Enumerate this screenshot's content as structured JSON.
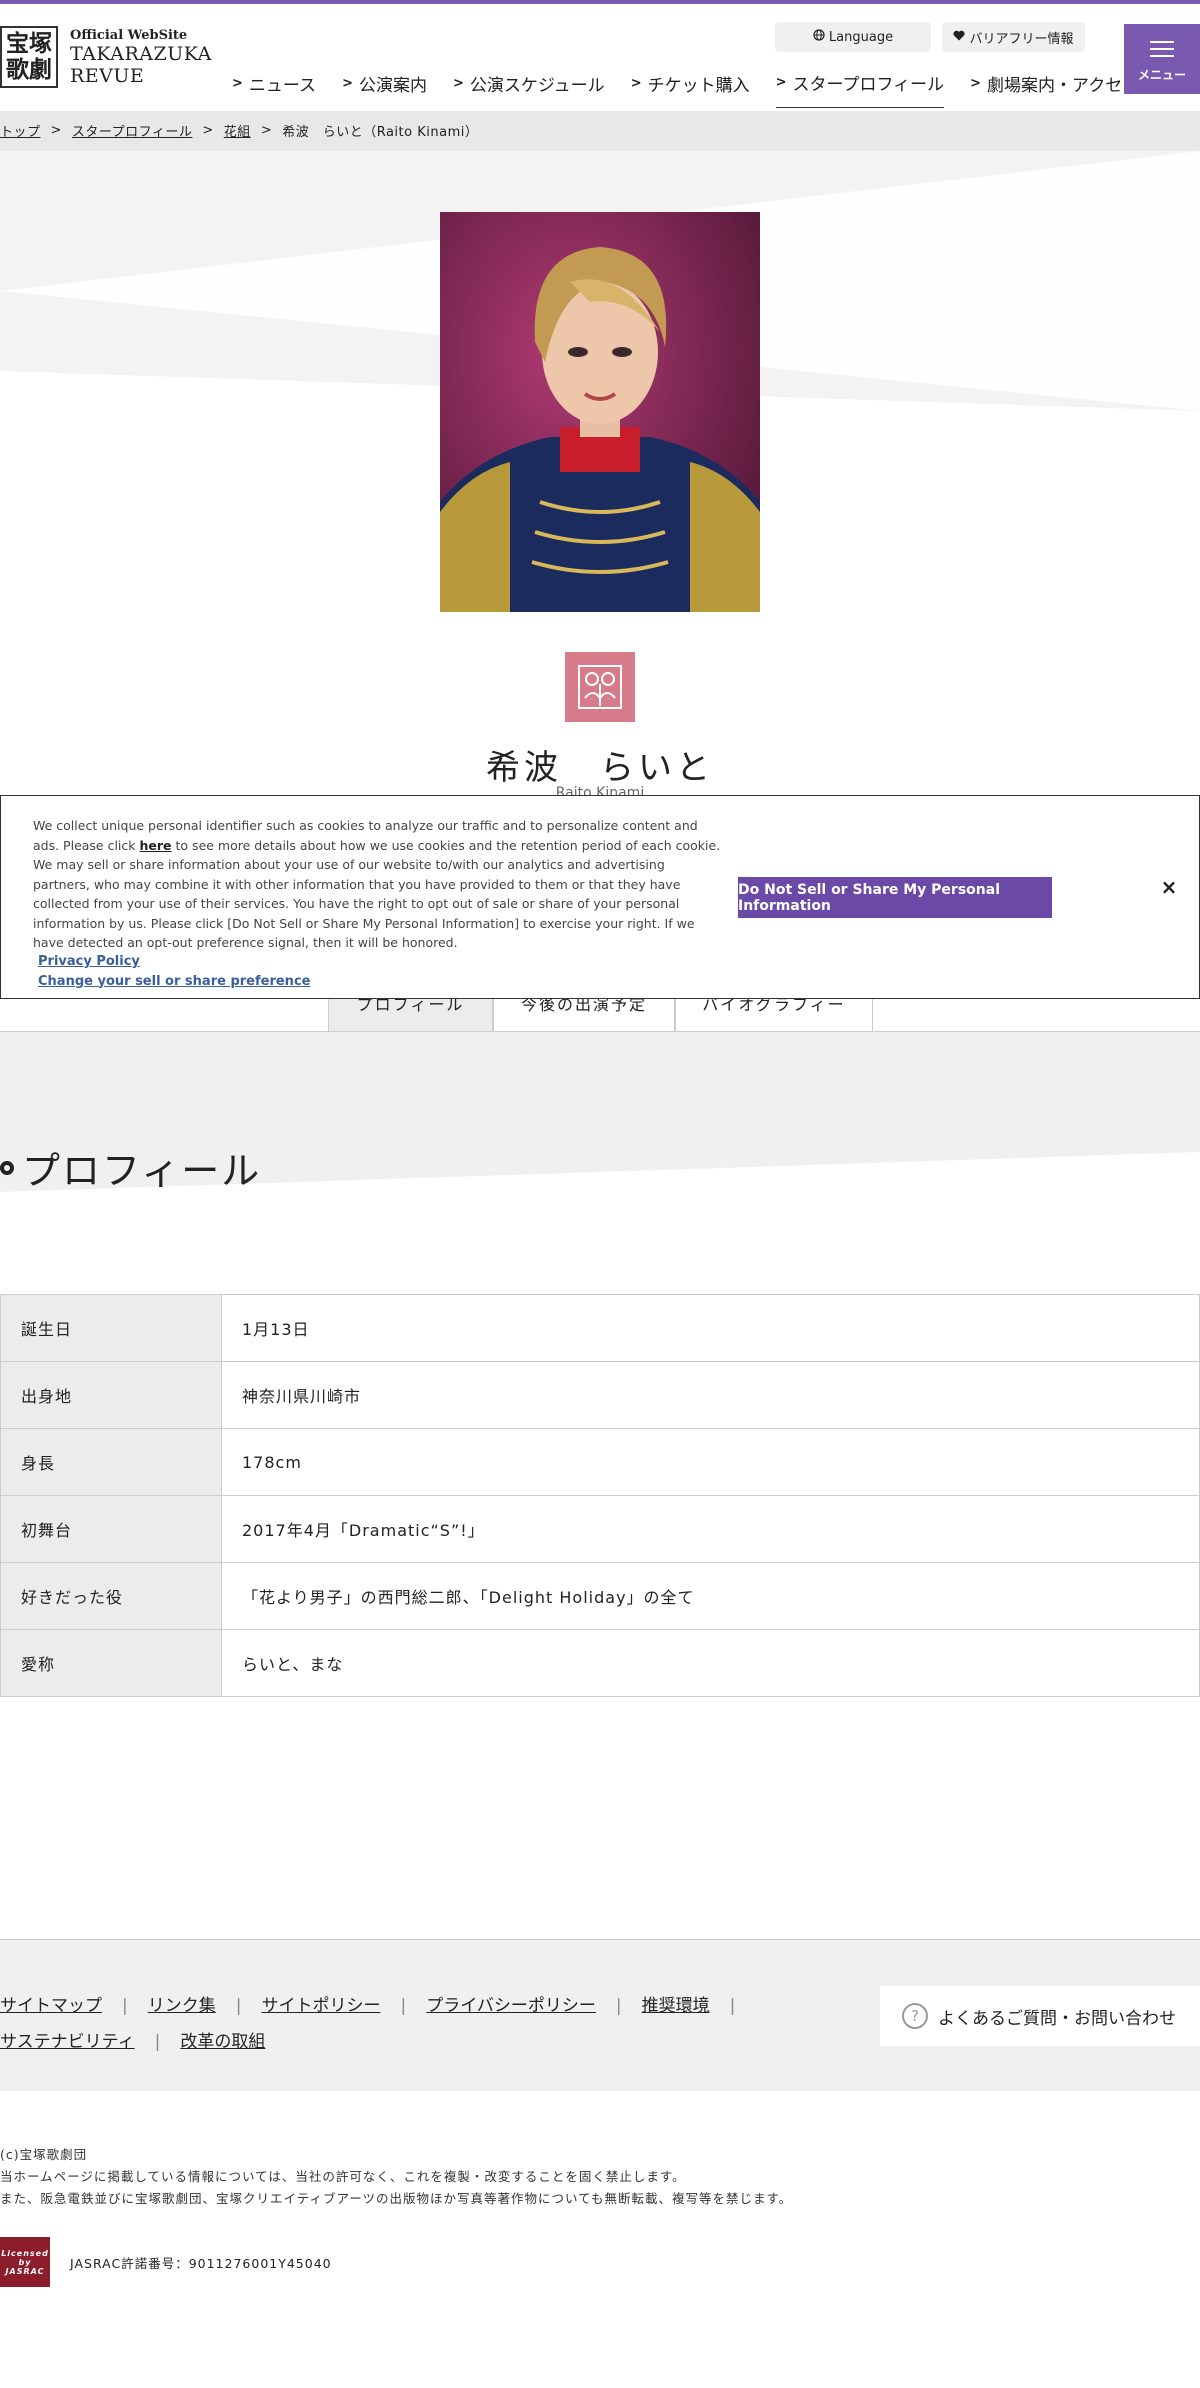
{
  "header": {
    "logo_kanji_1": "宝塚",
    "logo_kanji_2": "歌劇",
    "logo_sub": "Official WebSite",
    "logo_main_1": "TAKARAZUKA",
    "logo_main_2": "REVUE",
    "language_label": "Language",
    "barrier_free_label": "バリアフリー情報",
    "menu_label": "メニュー",
    "nav": [
      "ニュース",
      "公演案内",
      "公演スケジュール",
      "チケット購入",
      "スタープロフィール",
      "劇場案内・アクセス"
    ],
    "nav_active_index": 4
  },
  "breadcrumb": {
    "items": [
      "トップ",
      "スタープロフィール",
      "花組"
    ],
    "current": "希波　らいと（Raito Kinami）"
  },
  "profile_header": {
    "name": "希波　らいと",
    "name_roman": "Raito Kinami",
    "troupe_emblem": "flower-troupe-emblem"
  },
  "tabs": [
    "プロフィール",
    "今後の出演予定",
    "バイオグラフィー"
  ],
  "cookie": {
    "text_before_link": "We collect unique personal identifier such as cookies to analyze our traffic and to personalize content and ads. Please click",
    "link_here": "here",
    "text_after_link": "to see more details about how we use cookies and the retention period of each cookie. We may sell or share information about your use of our website to/with our analytics and advertising partners, who may combine it with other information that you have provided to them or that they have collected from your use of their services. You have the right to opt out of sale or share of your personal information by us. Please click [Do Not Sell or Share My Personal Information] to exercise your right. If we have detected an opt-out preference signal, then it will be honored.",
    "privacy_policy": "Privacy Policy",
    "change_preference": "Change your sell or share preference",
    "button": "Do Not Sell or Share My Personal Information",
    "close": "×"
  },
  "profile": {
    "title": "プロフィール",
    "rows": [
      {
        "label": "誕生日",
        "value": "1月13日"
      },
      {
        "label": "出身地",
        "value": "神奈川県川崎市"
      },
      {
        "label": "身長",
        "value": "178cm"
      },
      {
        "label": "初舞台",
        "value": "2017年4月「Dramatic“S”!」"
      },
      {
        "label": "好きだった役",
        "value": "「花より男子」の西門総二郎、「Delight Holiday」の全て"
      },
      {
        "label": "愛称",
        "value": "らいと、まな"
      }
    ]
  },
  "footer": {
    "links_row1": [
      "サイトマップ",
      "リンク集",
      "サイトポリシー",
      "プライバシーポリシー",
      "推奨環境"
    ],
    "links_row2": [
      "サステナビリティ",
      "改革の取組"
    ],
    "faq": "よくあるご質問・お問い合わせ",
    "copyright": "(c)宝塚歌劇団",
    "notice_1": "当ホームページに掲載している情報については、当社の許可なく、これを複製・改変することを固く禁止します。",
    "notice_2": "また、阪急電鉄並びに宝塚歌劇団、宝塚クリエイティブアーツの出版物ほか写真等著作物についても無断転載、複写等を禁じます。",
    "jasrac_logo_1": "Licensed",
    "jasrac_logo_2": "by",
    "jasrac_logo_3": "JASRAC",
    "jasrac": "JASRAC許諾番号：9011276001Y45040"
  },
  "colors": {
    "accent": "#7a5ab0",
    "cookie_button": "#6a4aa6",
    "emblem": "#d77a8a"
  }
}
